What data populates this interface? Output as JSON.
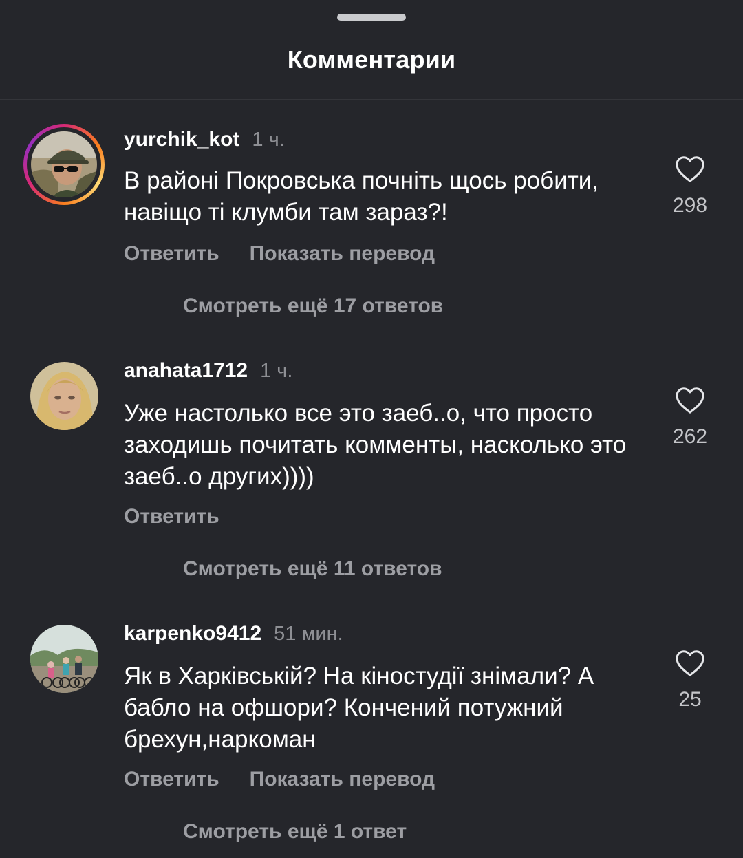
{
  "sheet": {
    "title": "Комментарии"
  },
  "colors": {
    "background": "#25262b",
    "text_primary": "#ffffff",
    "text_secondary": "#9d9ea3",
    "story_ring": [
      "#d62976",
      "#fa7e1e",
      "#feda75",
      "#962fbf"
    ]
  },
  "comments": [
    {
      "username": "yurchik_kot",
      "time": "1 ч.",
      "text": "В районі Покровська почніть щось робити, навіщо ті клумби там зараз?!",
      "likes": "298",
      "reply_label": "Ответить",
      "translate_label": "Показать перевод",
      "view_replies_label": "Смотреть ещё 17 ответов",
      "has_story_ring": true,
      "avatar_icon": "avatar-man-sunglasses-cap"
    },
    {
      "username": "anahata1712",
      "time": "1 ч.",
      "text": "Уже настолько все это заеб..о, что просто заходишь почитать комменты, насколько это заеб..о других))))",
      "likes": "262",
      "reply_label": "Ответить",
      "view_replies_label": "Смотреть ещё 11 ответов",
      "has_story_ring": false,
      "avatar_icon": "avatar-woman-portrait"
    },
    {
      "username": "karpenko9412",
      "time": "51 мин.",
      "text": "Як в Харківській? На кіностудії знімали? А бабло на офшори? Кончений потужний брехун,наркоман",
      "likes": "25",
      "reply_label": "Ответить",
      "translate_label": "Показать перевод",
      "view_replies_label": "Смотреть ещё 1 ответ",
      "has_story_ring": false,
      "avatar_icon": "avatar-family-bicycles"
    }
  ]
}
